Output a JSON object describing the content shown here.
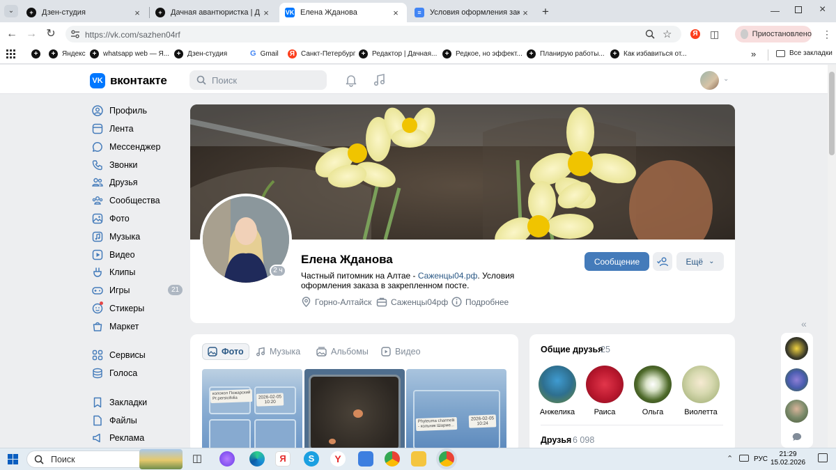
{
  "browser": {
    "tabs": [
      {
        "title": "Дзен-студия",
        "icon": "plus-circle-icon",
        "active": false
      },
      {
        "title": "Дачная авантюристка | Дзен",
        "icon": "plus-circle-icon",
        "active": false
      },
      {
        "title": "Елена Жданова",
        "icon": "vk-icon",
        "active": true
      },
      {
        "title": "Условия оформления заказа -",
        "icon": "docs-icon",
        "active": false
      }
    ],
    "new_tab_label": "+",
    "url": "https://vk.com/sazhen04rf",
    "profile_status": "Приостановлено",
    "bookmarks": [
      {
        "label": "",
        "icon": "apps-grid-icon"
      },
      {
        "label": "",
        "icon": "plus-circle-icon"
      },
      {
        "label": "Яндекс",
        "icon": "plus-circle-icon"
      },
      {
        "label": "whatsapp web — Я...",
        "icon": "plus-circle-icon"
      },
      {
        "label": "Дзен-студия",
        "icon": "plus-circle-icon"
      },
      {
        "label": "Gmail",
        "icon": "google-icon"
      },
      {
        "label": "Санкт-Петербург",
        "icon": "yandex-icon"
      },
      {
        "label": "Редактор | Дачная...",
        "icon": "plus-circle-icon"
      },
      {
        "label": "Редкое, но эффект...",
        "icon": "plus-circle-icon"
      },
      {
        "label": "Планирую работы...",
        "icon": "plus-circle-icon"
      },
      {
        "label": "Как избавиться от...",
        "icon": "plus-circle-icon"
      }
    ],
    "more_bookmarks": "»",
    "all_bookmarks": "Все закладки"
  },
  "vk": {
    "logo_text": "вконтакте",
    "logo_mark": "VK",
    "search_placeholder": "Поиск",
    "menu": [
      {
        "label": "Профиль",
        "icon": "profile-icon"
      },
      {
        "label": "Лента",
        "icon": "feed-icon"
      },
      {
        "label": "Мессенджер",
        "icon": "messenger-icon"
      },
      {
        "label": "Звонки",
        "icon": "phone-icon"
      },
      {
        "label": "Друзья",
        "icon": "friends-icon"
      },
      {
        "label": "Сообщества",
        "icon": "communities-icon"
      },
      {
        "label": "Фото",
        "icon": "photo-icon"
      },
      {
        "label": "Музыка",
        "icon": "music-icon"
      },
      {
        "label": "Видео",
        "icon": "video-icon"
      },
      {
        "label": "Клипы",
        "icon": "clips-icon"
      },
      {
        "label": "Игры",
        "icon": "games-icon",
        "badge": "21"
      },
      {
        "label": "Стикеры",
        "icon": "stickers-icon"
      },
      {
        "label": "Маркет",
        "icon": "market-icon"
      },
      {
        "label": "Сервисы",
        "icon": "services-icon"
      },
      {
        "label": "Голоса",
        "icon": "votes-icon"
      },
      {
        "label": "Закладки",
        "icon": "bookmarks-icon"
      },
      {
        "label": "Файлы",
        "icon": "files-icon"
      },
      {
        "label": "Реклама",
        "icon": "ads-icon"
      }
    ],
    "profile": {
      "name": "Елена Жданова",
      "online": "2 ч",
      "status_prefix": "Частный питомник на Алтае - ",
      "status_link": "Саженцы04.рф",
      "status_suffix": ". Условия оформления заказа в закрепленном посте.",
      "location": "Горно-Алтайск",
      "work": "Саженцы04рф",
      "more_info": "Подробнее",
      "btn_message": "Сообщение",
      "btn_more": "Ещё"
    },
    "media_tabs": [
      {
        "label": "Фото",
        "icon": "photo-icon",
        "active": true
      },
      {
        "label": "Музыка",
        "icon": "music-icon",
        "active": false
      },
      {
        "label": "Альбомы",
        "icon": "albums-icon",
        "active": false
      },
      {
        "label": "Видео",
        "icon": "video-icon",
        "active": false
      }
    ],
    "photos": [
      {
        "label_lines": [
          "колокол Пожарский",
          "Pr.persicifolia"
        ],
        "date": "2026-02-05",
        "time": "10:20"
      },
      {
        "label_lines": [],
        "date": "",
        "time": ""
      },
      {
        "label_lines": [
          "Phyteuma charmelii",
          "- кольник Шарме..."
        ],
        "date": "2026-02-05",
        "time": "10:24"
      }
    ],
    "common_friends": {
      "title": "Общие друзья",
      "count": "25"
    },
    "friends": [
      {
        "name": "Анжелика"
      },
      {
        "name": "Раиса"
      },
      {
        "name": "Ольга"
      },
      {
        "name": "Виолетта"
      }
    ],
    "all_friends": {
      "title": "Друзья",
      "count": "6 098"
    },
    "colors": {
      "accent": "#447bba",
      "link": "#2a5885",
      "muted": "#818c99",
      "page_bg": "#edeef0"
    }
  },
  "taskbar": {
    "search_label": "Поиск",
    "lang": "РУС",
    "time": "21:29",
    "date": "15.02.2026"
  }
}
